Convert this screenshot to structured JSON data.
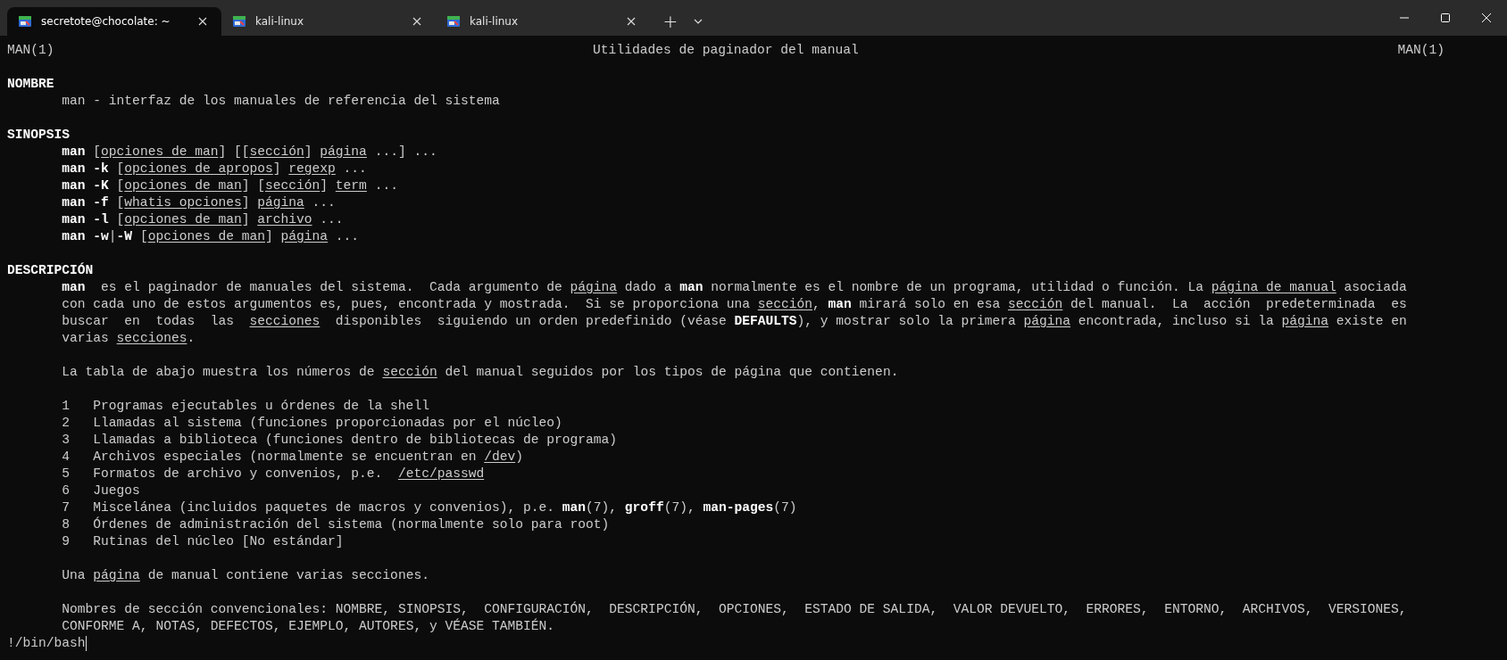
{
  "tabs": [
    {
      "title": "secretote@chocolate: ~",
      "selected": true
    },
    {
      "title": "kali-linux",
      "selected": false
    },
    {
      "title": "kali-linux",
      "selected": false
    }
  ],
  "new_tab": "+",
  "man_page": {
    "header": {
      "left": "MAN(1)",
      "center": "Utilidades de paginador del manual",
      "right": "MAN(1)"
    },
    "sections": [
      {
        "heading": "NOMBRE",
        "blocks": [
          {
            "kind": "paragraph",
            "lines": [
              [
                "man - interfaz de los manuales de referencia del sistema"
              ]
            ]
          }
        ]
      },
      {
        "heading": "SINOPSIS",
        "blocks": [
          {
            "kind": "commands",
            "lines": [
              [
                {
                  "text": "man",
                  "kind": "bold"
                },
                " [",
                {
                  "text": "opciones de man",
                  "kind": "underline"
                },
                "] [[",
                {
                  "text": "sección",
                  "kind": "underline"
                },
                "] ",
                {
                  "text": "página",
                  "kind": "underline"
                },
                " ...] ..."
              ],
              [
                {
                  "text": "man -k",
                  "kind": "bold"
                },
                " [",
                {
                  "text": "opciones de apropos",
                  "kind": "underline"
                },
                "] ",
                {
                  "text": "regexp",
                  "kind": "underline"
                },
                " ..."
              ],
              [
                {
                  "text": "man -K",
                  "kind": "bold"
                },
                " [",
                {
                  "text": "opciones de man",
                  "kind": "underline"
                },
                "] [",
                {
                  "text": "sección",
                  "kind": "underline"
                },
                "] ",
                {
                  "text": "term",
                  "kind": "underline"
                },
                " ..."
              ],
              [
                {
                  "text": "man -f",
                  "kind": "bold"
                },
                " [",
                {
                  "text": "whatis opciones",
                  "kind": "underline"
                },
                "] ",
                {
                  "text": "página",
                  "kind": "underline"
                },
                " ..."
              ],
              [
                {
                  "text": "man -l",
                  "kind": "bold"
                },
                " [",
                {
                  "text": "opciones de man",
                  "kind": "underline"
                },
                "] ",
                {
                  "text": "archivo",
                  "kind": "underline"
                },
                " ..."
              ],
              [
                {
                  "text": "man -w",
                  "kind": "bold"
                },
                "|",
                {
                  "text": "-W",
                  "kind": "bold"
                },
                " [",
                {
                  "text": "opciones de man",
                  "kind": "underline"
                },
                "] ",
                {
                  "text": "página",
                  "kind": "underline"
                },
                " ..."
              ]
            ]
          }
        ]
      },
      {
        "heading": "DESCRIPCIÓN",
        "blocks": [
          {
            "kind": "paragraph",
            "lines": [
              [
                {
                  "text": "man",
                  "kind": "bold"
                },
                "  es el paginador de manuales del sistema.  Cada argumento de ",
                {
                  "text": "página",
                  "kind": "underline"
                },
                " dado a ",
                {
                  "text": "man",
                  "kind": "bold"
                },
                " normalmente es el nombre de un programa, utilidad o función. La ",
                {
                  "text": "página de manual",
                  "kind": "underline"
                },
                " asociada"
              ],
              [
                "con cada uno de estos argumentos es, pues, encontrada y mostrada.  Si se proporciona una ",
                {
                  "text": "sección",
                  "kind": "underline"
                },
                ", ",
                {
                  "text": "man",
                  "kind": "bold"
                },
                " mirará solo en esa ",
                {
                  "text": "sección",
                  "kind": "underline"
                },
                " del manual.  La  acción  predeterminada  es"
              ],
              [
                "buscar  en  todas  las  ",
                {
                  "text": "secciones",
                  "kind": "underline"
                },
                "  disponibles  siguiendo un orden predefinido (véase ",
                {
                  "text": "DEFAULTS",
                  "kind": "bold"
                },
                "), y mostrar solo la primera ",
                {
                  "text": "página",
                  "kind": "underline"
                },
                " encontrada, incluso si la ",
                {
                  "text": "página",
                  "kind": "underline"
                },
                " existe en"
              ],
              [
                "varias ",
                {
                  "text": "secciones",
                  "kind": "underline"
                },
                "."
              ]
            ]
          },
          {
            "kind": "paragraph",
            "lines": [
              [
                "La tabla de abajo muestra los números de ",
                {
                  "text": "sección",
                  "kind": "underline"
                },
                " del manual seguidos por los tipos de página que contienen."
              ]
            ]
          },
          {
            "kind": "table",
            "rows": [
              {
                "number": "1",
                "text": [
                  "Programas ejecutables u órdenes de la shell"
                ]
              },
              {
                "number": "2",
                "text": [
                  "Llamadas al sistema (funciones proporcionadas por el núcleo)"
                ]
              },
              {
                "number": "3",
                "text": [
                  "Llamadas a biblioteca (funciones dentro de bibliotecas de programa)"
                ]
              },
              {
                "number": "4",
                "text": [
                  "Archivos especiales (normalmente se encuentran en ",
                  {
                    "text": "/dev",
                    "kind": "underline"
                  },
                  ")"
                ]
              },
              {
                "number": "5",
                "text": [
                  "Formatos de archivo y convenios, p.e.  ",
                  {
                    "text": "/etc/passwd",
                    "kind": "underline"
                  }
                ]
              },
              {
                "number": "6",
                "text": [
                  "Juegos"
                ]
              },
              {
                "number": "7",
                "text": [
                  "Miscelánea (incluidos paquetes de macros y convenios), p.e. ",
                  {
                    "text": "man",
                    "kind": "bold"
                  },
                  "(7), ",
                  {
                    "text": "groff",
                    "kind": "bold"
                  },
                  "(7), ",
                  {
                    "text": "man-pages",
                    "kind": "bold"
                  },
                  "(7)"
                ]
              },
              {
                "number": "8",
                "text": [
                  "Órdenes de administración del sistema (normalmente solo para root)"
                ]
              },
              {
                "number": "9",
                "text": [
                  "Rutinas del núcleo [No estándar]"
                ]
              }
            ]
          },
          {
            "kind": "paragraph",
            "lines": [
              [
                "Una ",
                {
                  "text": "página",
                  "kind": "underline"
                },
                " de manual contiene varias secciones."
              ]
            ]
          },
          {
            "kind": "paragraph",
            "lines": [
              [
                "Nombres de sección convencionales: NOMBRE, SINOPSIS,  CONFIGURACIÓN,  DESCRIPCIÓN,  OPCIONES,  ESTADO DE SALIDA,  VALOR DEVUELTO,  ERRORES,  ENTORNO,  ARCHIVOS,  VERSIONES,"
              ],
              [
                "CONFORME A, NOTAS, DEFECTOS, EJEMPLO, AUTORES, y VÉASE TAMBIÉN."
              ]
            ]
          }
        ]
      }
    ]
  },
  "prompt": "!/bin/bash"
}
